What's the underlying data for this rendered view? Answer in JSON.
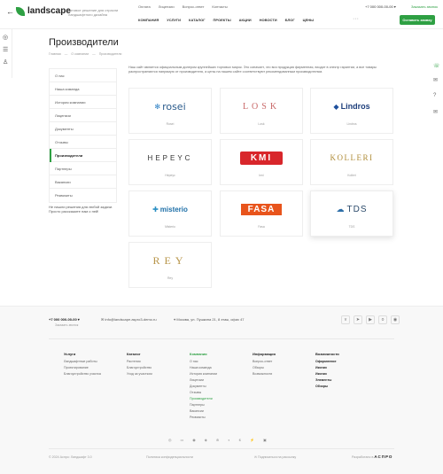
{
  "header": {
    "back": "←",
    "logo": "landscape",
    "tagline": "Готовое решение для отрасли ландшафтного дизайна",
    "top_links": [
      "Оплата",
      "Лицензии",
      "Вопрос-ответ",
      "Контакты"
    ],
    "phone": "+7 000 000-00-00 ▾",
    "callback": "Заказать звонок",
    "nav": [
      "Компания",
      "Услуги",
      "Каталог",
      "Проекты",
      "Акции",
      "Новости",
      "Блог",
      "Цены"
    ],
    "more": "···",
    "request": "Оставить заявку"
  },
  "page": {
    "title": "Производители",
    "breadcrumbs": [
      "Главная",
      "—",
      "О компании",
      "—",
      "Производители"
    ],
    "intro": "Наш сайт является официальным дилером крупнейших торговых марок. Это означает, что вся продукция фирменная, входит в спектр гарантии, а все товары распространяются напрямую от производителя, а цены на нашем сайте соответствуют рекомендованным производителям."
  },
  "sidebar": {
    "items": [
      "О нас",
      "Наша команда",
      "История компании",
      "Лицензии",
      "Документы",
      "Отзывы",
      "Производители",
      "Партнеры",
      "Вакансии",
      "Реквизиты"
    ],
    "active": "Производители",
    "help": "Не нашли решения для любой задачи. Просто расскажите нам о ней!"
  },
  "brands": [
    {
      "logo": "rosei",
      "caption": "Rosei"
    },
    {
      "logo": "LOSK",
      "caption": "Losk"
    },
    {
      "logo": "Lindros",
      "caption": "Lindros"
    },
    {
      "logo": "HEPEYC",
      "caption": "Нерeус"
    },
    {
      "logo": "KMI",
      "caption": "kmi"
    },
    {
      "logo": "KOLLERI",
      "caption": "Kolleri"
    },
    {
      "logo": "misterio",
      "caption": "Misterio"
    },
    {
      "logo": "FASA",
      "caption": "Fasa"
    },
    {
      "logo": "TDS",
      "caption": "TDS"
    },
    {
      "logo": "REY",
      "caption": "Rey"
    }
  ],
  "footer": {
    "phone": "+7 000 000-00-00 ▾",
    "call": "Заказать звонок",
    "email": "info@landscape.aspro3-demo.ru",
    "address": "Москва, ул. Пушкина 21, 8 этаж, офис 47",
    "cols": [
      {
        "h": "Услуги",
        "items": [
          "Ландшафтные работы",
          "Проектирование",
          "Благоустройство участка"
        ]
      },
      {
        "h": "Каталог",
        "items": [
          "Растения",
          "Благоустройство",
          "Уход за участком"
        ]
      },
      {
        "h": "Компания",
        "items": [
          "О нас",
          "Наша команда",
          "История компании",
          "Лицензии",
          "Документы",
          "Отзывы",
          "Производители",
          "Партнеры",
          "Вакансии",
          "Реквизиты"
        ]
      },
      {
        "h": "Информация",
        "items": [
          "Вопрос-ответ",
          "Обзоры",
          "Возможности"
        ]
      },
      {
        "h": "Возможности",
        "items": [
          "Оформление",
          "Иконки",
          "Иконки",
          "Элементы",
          "Обзоры"
        ]
      }
    ],
    "payments": [
      "◎",
      "▭",
      "◉",
      "◈",
      "⊛",
      "◐",
      "ϐ",
      "⚡",
      "▣"
    ],
    "copyright": "© 2024 Аспро: Ландшафт 3.0",
    "policy": "Политика конфиденциальности",
    "version": "Подписаться на рассылку",
    "made_by": "Разработано в",
    "made_brand": "АСПРО"
  }
}
